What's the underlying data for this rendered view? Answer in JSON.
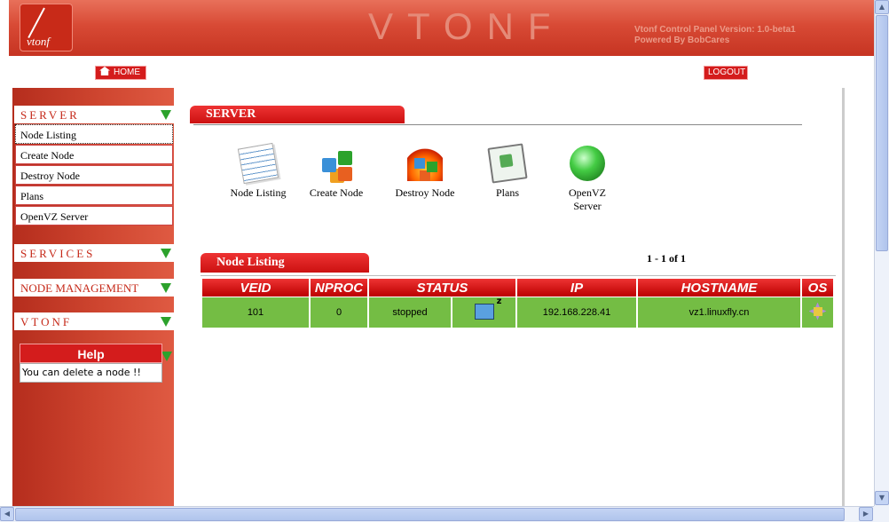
{
  "header": {
    "logo_text": "vtonf",
    "brand": "VTONF",
    "version_line1": "Vtonf Control Panel Version: 1.0-beta1",
    "version_line2": "Powered By BobCares"
  },
  "nav": {
    "home_label": "HOME",
    "logout_label": "LOGOUT"
  },
  "sidebar": {
    "server_title": "SERVER",
    "menu": [
      {
        "label": "Node Listing",
        "active": true
      },
      {
        "label": "Create Node"
      },
      {
        "label": "Destroy Node"
      },
      {
        "label": "Plans"
      },
      {
        "label": "OpenVZ Server"
      }
    ],
    "services_title": "SERVICES",
    "node_mgmt_title": "NODE MANAGEMENT",
    "vtonf_title": "VTONF",
    "help_title": "Help",
    "help_text": "You can delete a node !!"
  },
  "main": {
    "server_tab": "SERVER",
    "icons": [
      {
        "label": "Node Listing",
        "icon": "notepad-icon"
      },
      {
        "label": "Create Node",
        "icon": "cubes-icon"
      },
      {
        "label": "Destroy Node",
        "icon": "fire-cubes-icon"
      },
      {
        "label": "Plans",
        "icon": "plans-icon"
      },
      {
        "label1": "OpenVZ",
        "label2": "Server",
        "icon": "globe-icon"
      }
    ],
    "listing_tab": "Node Listing",
    "pager": "1 - 1 of 1",
    "table": {
      "headers": [
        "VEID",
        "NPROC",
        "STATUS",
        "IP",
        "HOSTNAME",
        "OS"
      ],
      "rows": [
        {
          "veid": "101",
          "nproc": "0",
          "status": "stopped",
          "ip": "192.168.228.41",
          "hostname": "vz1.linuxfly.cn"
        }
      ]
    }
  },
  "colors": {
    "header_red": "#d84a35",
    "button_red": "#d41c1c",
    "row_green": "#74bd44",
    "arrow_green": "#2ca22c"
  }
}
